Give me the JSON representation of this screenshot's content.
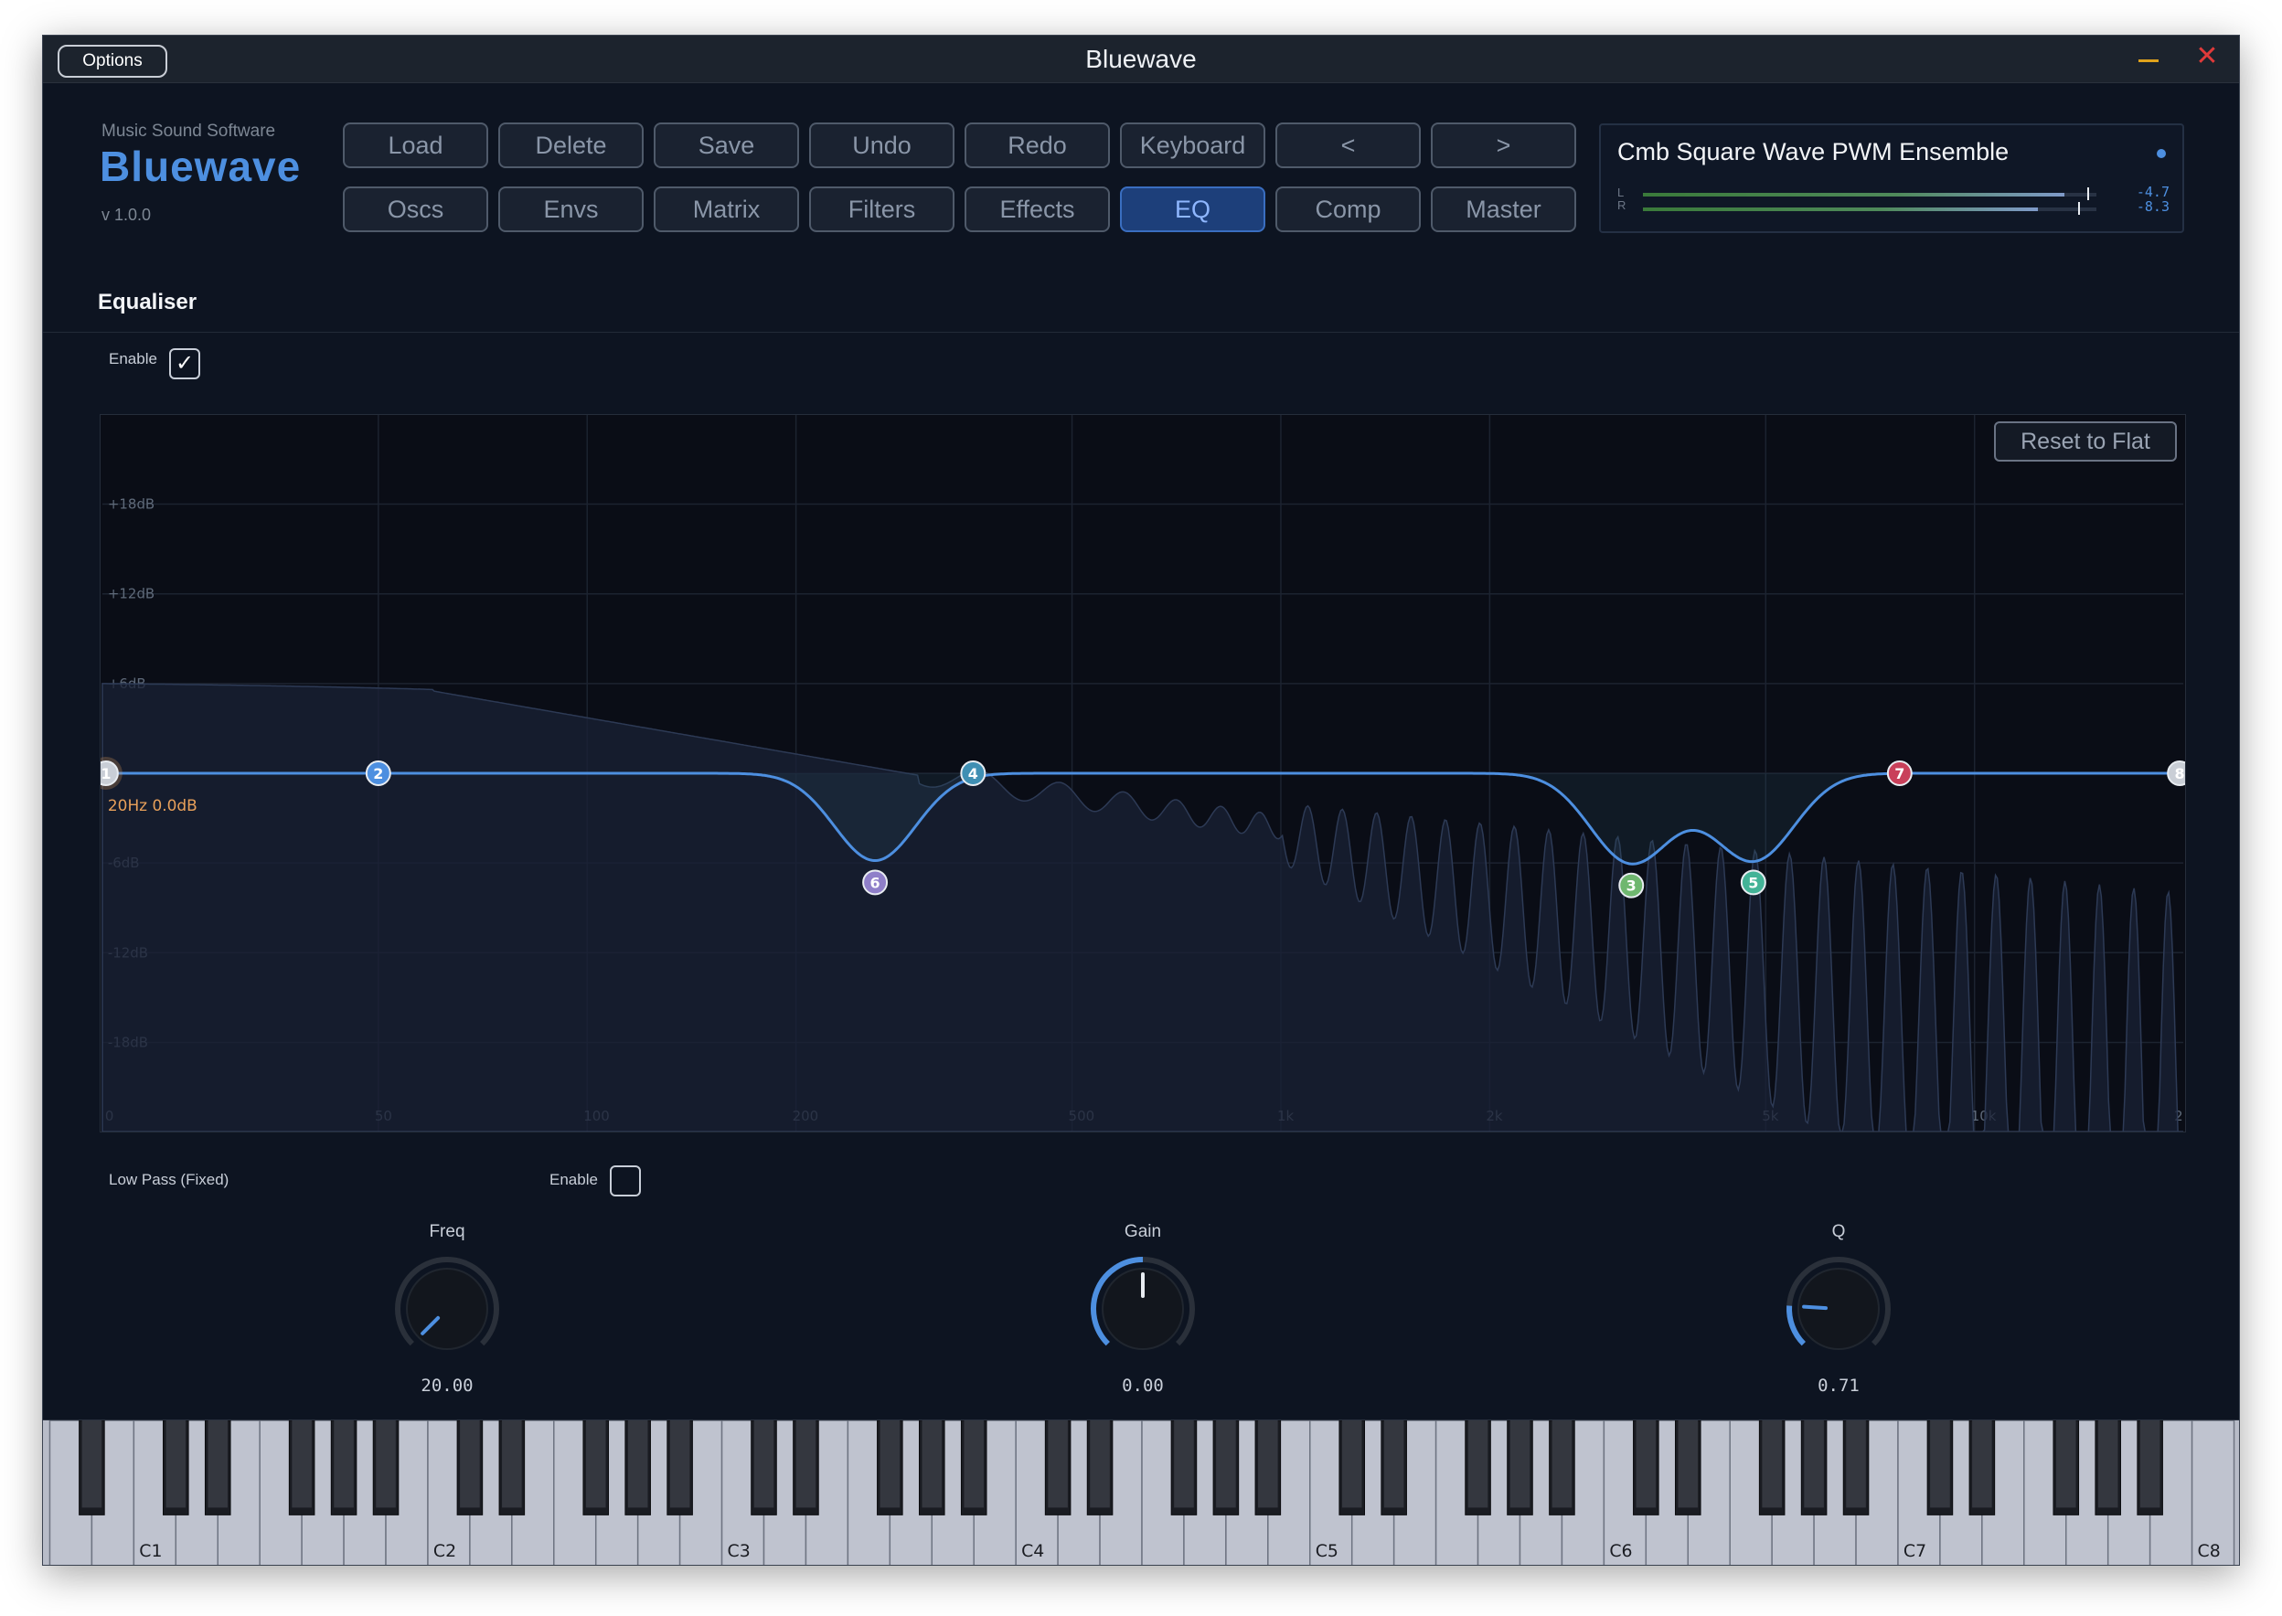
{
  "window": {
    "title": "Bluewave",
    "options_label": "Options"
  },
  "brand": {
    "company": "Music Sound Software",
    "name": "Bluewave",
    "version": "v 1.0.0"
  },
  "nav": {
    "row1": [
      "Load",
      "Delete",
      "Save",
      "Undo",
      "Redo",
      "Keyboard",
      "<",
      ">"
    ],
    "row2": [
      "Oscs",
      "Envs",
      "Matrix",
      "Filters",
      "Effects",
      "EQ",
      "Comp",
      "Master"
    ],
    "active": "EQ"
  },
  "preset": {
    "name": "Cmb Square Wave PWM Ensemble",
    "meters": {
      "left_label": "L",
      "right_label": "R",
      "left_value": "-4.7",
      "right_value": "-8.3",
      "left_level": 0.93,
      "right_level": 0.87,
      "left_peak": 0.98,
      "right_peak": 0.96
    }
  },
  "equaliser": {
    "title": "Equaliser",
    "enable_label": "Enable",
    "enabled": true,
    "reset_label": "Reset to Flat",
    "selected_readout": {
      "freq": "20Hz",
      "gain": "0.0dB"
    },
    "db_labels": [
      "+18dB",
      "+12dB",
      "+6dB",
      "-6dB",
      "-12dB",
      "-18dB"
    ],
    "freq_labels": [
      "0",
      "50",
      "100",
      "200",
      "500",
      "1k",
      "2k",
      "5k",
      "10k",
      "2"
    ],
    "bands": [
      {
        "id": "1",
        "freq": 20,
        "gain": 0,
        "color": "#c9ced6"
      },
      {
        "id": "2",
        "freq": 50,
        "gain": 0,
        "color": "#4d8fe0"
      },
      {
        "id": "3",
        "freq": 3200,
        "gain": -7.5,
        "color": "#6fb76f"
      },
      {
        "id": "4",
        "freq": 360,
        "gain": 0,
        "color": "#3f8fb3"
      },
      {
        "id": "5",
        "freq": 4800,
        "gain": -7.3,
        "color": "#43b397"
      },
      {
        "id": "6",
        "freq": 260,
        "gain": -7.3,
        "color": "#8f7fc9"
      },
      {
        "id": "7",
        "freq": 7800,
        "gain": 0,
        "color": "#c9405a"
      },
      {
        "id": "8",
        "freq": 20000,
        "gain": 0,
        "color": "#c9ced6"
      }
    ]
  },
  "band_panel": {
    "type_label": "Low Pass (Fixed)",
    "enable_label": "Enable",
    "enabled": false,
    "knobs": [
      {
        "label": "Freq",
        "value": "20.00",
        "fraction": 0.0
      },
      {
        "label": "Gain",
        "value": "0.00",
        "fraction": 0.5
      },
      {
        "label": "Q",
        "value": "0.71",
        "fraction": 0.18
      }
    ]
  },
  "keyboard": {
    "octave_labels": [
      "C1",
      "C2",
      "C3",
      "C4",
      "C5",
      "C6",
      "C7",
      "C8"
    ]
  },
  "colors": {
    "accent": "#4d8fe0",
    "background": "#0d1421",
    "close": "#e03a3a",
    "minimize": "#e0a21c",
    "readout": "#e8a05a"
  }
}
